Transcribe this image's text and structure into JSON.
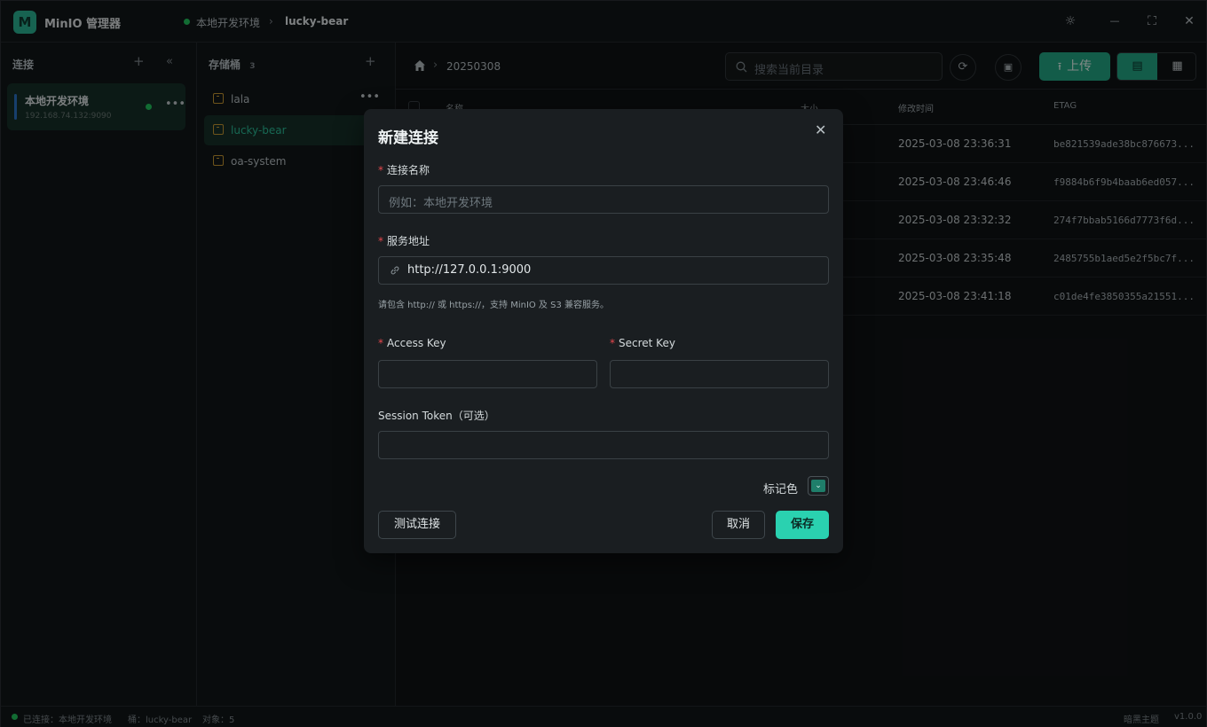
{
  "app": {
    "logo": "M",
    "title": "MinIO 管理器"
  },
  "breadcrumb": {
    "connection": "本地开发环境",
    "bucket": "lucky-bear"
  },
  "window_controls": {
    "theme": "☼",
    "minimize": "—",
    "maximize": "⛶",
    "close": "✕"
  },
  "connections": {
    "heading": "连接",
    "items": [
      {
        "name": "本地开发环境",
        "address": "192.168.74.132:9090"
      }
    ]
  },
  "buckets": {
    "heading": "存储桶",
    "count": "3",
    "items": [
      {
        "name": "lala"
      },
      {
        "name": "lucky-bear"
      },
      {
        "name": "oa-system"
      }
    ]
  },
  "toolbar": {
    "path": "20250308",
    "search_placeholder": "搜索当前目录",
    "upload_label": "上传"
  },
  "table": {
    "headers": {
      "name": "名称",
      "size": "大小",
      "modified": "修改时间",
      "etag": "ETAG"
    },
    "rows": [
      {
        "modified": "2025-03-08 23:36:31",
        "etag": "be821539ade38bc876673..."
      },
      {
        "modified": "2025-03-08 23:46:46",
        "etag": "f9884b6f9b4baab6ed057..."
      },
      {
        "modified": "2025-03-08 23:32:32",
        "etag": "274f7bbab5166d7773f6d..."
      },
      {
        "modified": "2025-03-08 23:35:48",
        "etag": "2485755b1aed5e2f5bc7f..."
      },
      {
        "modified": "2025-03-08 23:41:18",
        "etag": "c01de4fe3850355a21551..."
      }
    ]
  },
  "statusbar": {
    "connected": "已连接：本地开发环境",
    "bucket": "桶：lucky-bear",
    "objects": "对象：5",
    "theme": "暗黑主题",
    "version": "v1.0.0"
  },
  "modal": {
    "title": "新建连接",
    "name_label": "连接名称",
    "name_placeholder": "例如：本地开发环境",
    "endpoint_label": "服务地址",
    "endpoint_value": "http://127.0.0.1:9000",
    "endpoint_hint": "请包含 http:// 或 https://，支持 MinIO 及 S3 兼容服务。",
    "access_key_label": "Access Key",
    "secret_key_label": "Secret Key",
    "session_token_label": "Session Token（可选）",
    "color_label": "标记色",
    "color_value": "#1f7e6a",
    "test_label": "测试连接",
    "cancel_label": "取消",
    "save_label": "保存",
    "required_mark": "*"
  },
  "colors": {
    "accent": "#23a886",
    "accent_bright": "#2ad1b0",
    "status_ok": "#22c55e"
  }
}
